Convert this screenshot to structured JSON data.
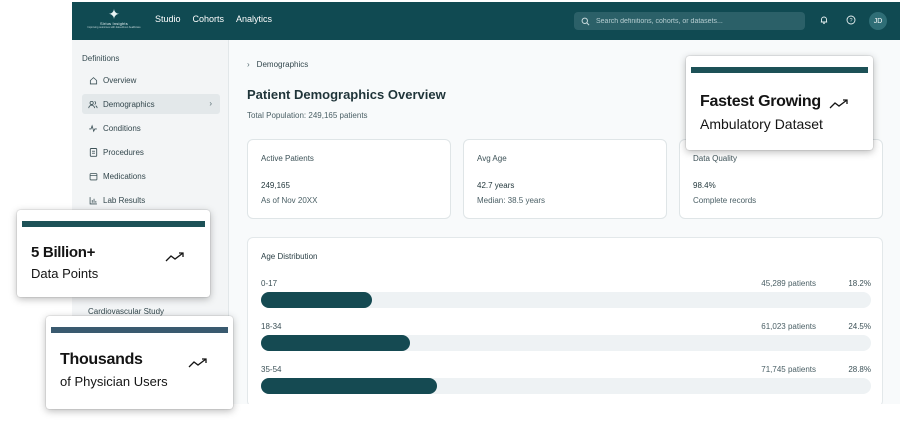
{
  "topbar": {
    "logo_brand": "Sirius Insights",
    "logo_tagline": "Improving outcomes with data-driven healthcare",
    "nav": [
      "Studio",
      "Cohorts",
      "Analytics"
    ],
    "search_placeholder": "Search definitions, cohorts, or datasets...",
    "avatar_initials": "JD",
    "colors": {
      "bar": "#104a52",
      "search": "#2b6068"
    }
  },
  "sidebar": {
    "title": "Definitions",
    "items": [
      {
        "label": "Overview",
        "icon": "home-icon"
      },
      {
        "label": "Demographics",
        "icon": "users-icon"
      },
      {
        "label": "Conditions",
        "icon": "activity-icon"
      },
      {
        "label": "Procedures",
        "icon": "clipboard-icon"
      },
      {
        "label": "Medications",
        "icon": "calendar-icon"
      },
      {
        "label": "Lab Results",
        "icon": "bar-chart-icon"
      }
    ],
    "study": "Cardiovascular Study"
  },
  "main": {
    "breadcrumb": "Demographics",
    "title": "Patient Demographics Overview",
    "subtitle": "Total Population: 249,165 patients",
    "cards": [
      {
        "label": "Active Patients",
        "value": "249,165",
        "note": "As of Nov 20XX"
      },
      {
        "label": "Avg Age",
        "value": "42.7 years",
        "note": "Median: 38.5 years"
      },
      {
        "label": "Data Quality",
        "value": "98.4%",
        "note": "Complete records"
      }
    ],
    "distribution": {
      "title": "Age Distribution",
      "rows": [
        {
          "range": "0-17",
          "count": "45,289 patients",
          "percent": "18.2%",
          "fraction": 0.182
        },
        {
          "range": "18-34",
          "count": "61,023 patients",
          "percent": "24.5%",
          "fraction": 0.245
        },
        {
          "range": "35-54",
          "count": "71,745 patients",
          "percent": "28.8%",
          "fraction": 0.288
        }
      ]
    }
  },
  "callouts": {
    "fastest": {
      "title": "Fastest Growing",
      "subtitle": "Ambulatory Dataset",
      "bar_color": "#1d5157"
    },
    "billion": {
      "title": "5 Billion+",
      "subtitle": "Data Points",
      "bar_color": "#1d5157"
    },
    "physicians": {
      "title": "Thousands",
      "subtitle": "of Physician Users",
      "bar_color": "#3a5a6f"
    }
  }
}
